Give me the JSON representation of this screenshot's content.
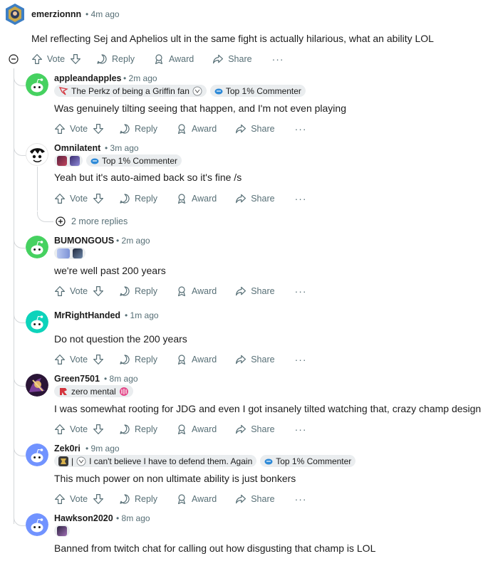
{
  "colors": {
    "text": "#1c1c1c",
    "meta": "#576f76",
    "flair_bg": "#eaedef",
    "thread_line": "#d4d7da",
    "reddit_green": "#46d160",
    "reddit_teal": "#0dd3bb",
    "reddit_blue": "#7193ff"
  },
  "root": {
    "username": "emerzionnn",
    "time": "4m ago",
    "body": "Mel reflecting Sej and Aphelios ult in the same fight is actually hilarious, what an ability LOL",
    "collapse_icon": "minus-circle-icon"
  },
  "actions": {
    "vote": "Vote",
    "reply": "Reply",
    "award": "Award",
    "share": "Share",
    "more": "···"
  },
  "comments": [
    {
      "username": "appleandapples",
      "time": "2m ago",
      "flairs": [
        "The Perkz of being a Griffin fan",
        "Top 1% Commenter"
      ],
      "body": "Was genuinely tilting seeing that happen, and I'm not even playing"
    },
    {
      "username": "Omnilatent",
      "time": "3m ago",
      "flairs": [
        "Top 1% Commenter"
      ],
      "body": "Yeah but it's auto-aimed back so it's fine /s"
    },
    {
      "username": "BUMONGOUS",
      "time": "2m ago",
      "flairs": [],
      "body": "we're well past 200 years"
    },
    {
      "username": "MrRightHanded",
      "time": "1m ago",
      "flairs": [],
      "body": "Do not question the 200 years"
    },
    {
      "username": "Green7501",
      "time": "8m ago",
      "flairs": [
        "zero mental"
      ],
      "body": "I was somewhat rooting for JDG and even I got insanely tilted watching that, crazy champ design"
    },
    {
      "username": "Zek0ri",
      "time": "9m ago",
      "flairs": [
        "|",
        "I can't believe I have to defend them. Again",
        "Top 1% Commenter"
      ],
      "body": "This much power on non ultimate ability is just bonkers"
    },
    {
      "username": "Hawkson2020",
      "time": "8m ago",
      "flairs": [],
      "body": "Banned from twitch chat for calling out how disgusting that champ is LOL"
    }
  ],
  "more_replies": "2 more replies"
}
